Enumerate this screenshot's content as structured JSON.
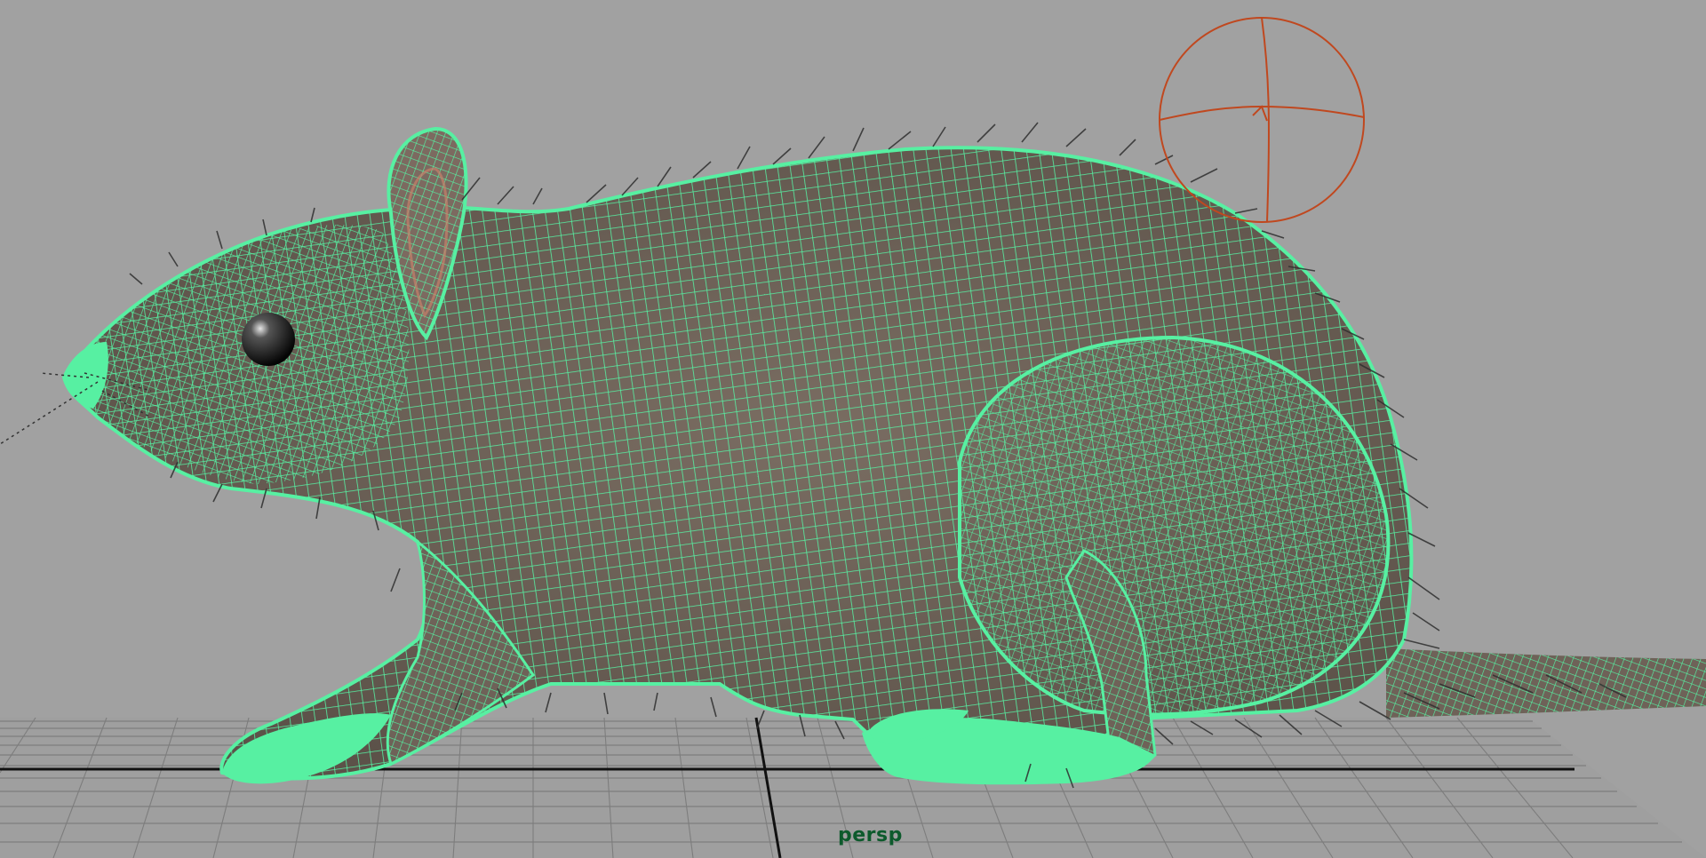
{
  "viewport": {
    "camera_label": "persp",
    "background_color": "#a1a1a1",
    "wireframe_color": "#57f0a2",
    "surface_color": "#6e6258",
    "grid_color": "#7d7d7d",
    "manipulator_color": "#c0481f"
  },
  "scene": {
    "model": "rat-icon",
    "grid": "ground-grid-icon",
    "manipulator": "rotate-manipulator-icon"
  }
}
